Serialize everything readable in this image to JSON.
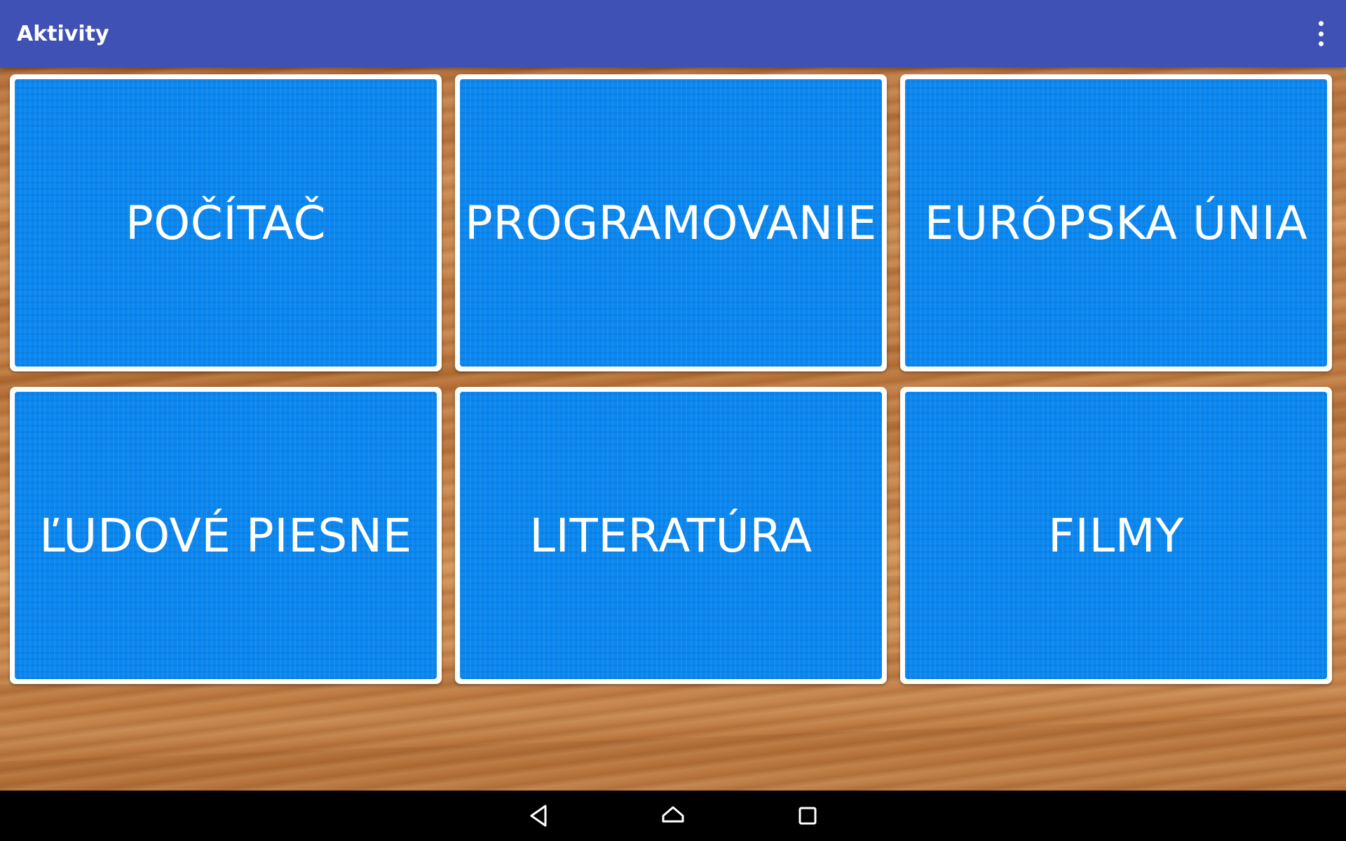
{
  "app": {
    "title": "Aktivity"
  },
  "toolbar": {
    "overflow_icon": "more-vert-icon"
  },
  "tiles": [
    {
      "label": "POČÍTAČ"
    },
    {
      "label": "PROGRAMOVANIE"
    },
    {
      "label": "EURÓPSKA ÚNIA"
    },
    {
      "label": "ĽUDOVÉ PIESNE"
    },
    {
      "label": "LITERATÚRA"
    },
    {
      "label": "FILMY"
    }
  ],
  "navbar": {
    "icons": [
      "back-icon",
      "home-icon",
      "recents-icon"
    ]
  },
  "colors": {
    "appbar": "#3f51b5",
    "tile_fill": "#0a87f0",
    "tile_border": "#ffffff",
    "navbar": "#000000"
  }
}
